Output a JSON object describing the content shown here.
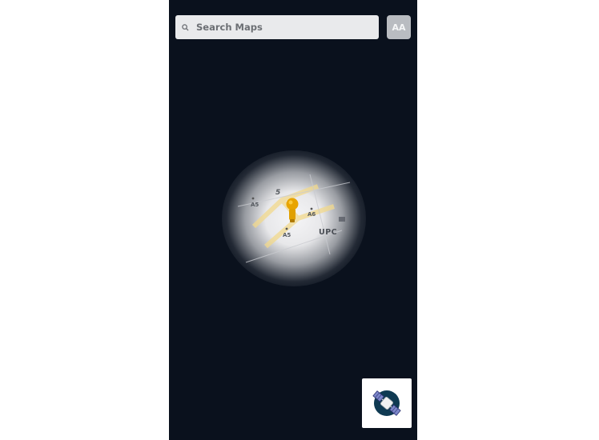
{
  "search": {
    "placeholder": "Search Maps"
  },
  "text_size_button": {
    "label": "AA"
  },
  "map": {
    "labels": {
      "road_number_5": "5",
      "a5_top": "A5",
      "a6": "A6",
      "a5_bottom": "A5",
      "area_fragment": "UPC"
    }
  },
  "icons": {
    "search": "magnifier-icon",
    "pin": "location-pin-icon",
    "satellite": "satellite-icon"
  },
  "colors": {
    "map_background": "#0a111d",
    "pin": "#e8a400",
    "satellite_circle": "#0f3a52",
    "satellite_panels": "#7c86c9"
  }
}
